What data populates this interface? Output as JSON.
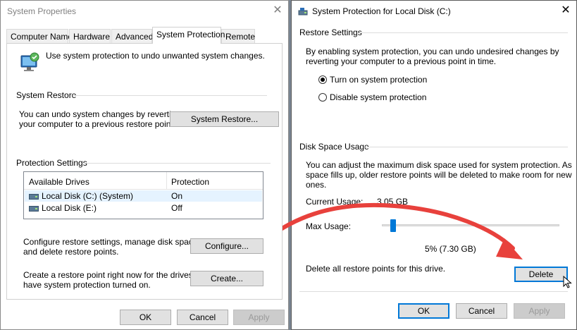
{
  "left_dialog": {
    "title": "System Properties",
    "tabs": [
      "Computer Name",
      "Hardware",
      "Advanced",
      "System Protection",
      "Remote"
    ],
    "active_tab": "System Protection",
    "intro_text": "Use system protection to undo unwanted system changes.",
    "system_restore": {
      "heading": "System Restore",
      "description_line1": "You can undo system changes by reverting",
      "description_line2": "your computer to a previous restore point.",
      "button": "System Restore..."
    },
    "protection_settings": {
      "heading": "Protection Settings",
      "columns": [
        "Available Drives",
        "Protection"
      ],
      "rows": [
        {
          "drive": "Local Disk (C:) (System)",
          "protection": "On"
        },
        {
          "drive": "Local Disk (E:)",
          "protection": "Off"
        }
      ],
      "configure_text_line1": "Configure restore settings, manage disk space,",
      "configure_text_line2": "and delete restore points.",
      "configure_button": "Configure...",
      "create_text_line1": "Create a restore point right now for the drives that",
      "create_text_line2": "have system protection turned on.",
      "create_button": "Create..."
    },
    "footer": {
      "ok": "OK",
      "cancel": "Cancel",
      "apply": "Apply"
    }
  },
  "right_dialog": {
    "title": "System Protection for Local Disk (C:)",
    "restore_settings": {
      "heading": "Restore Settings",
      "description_line1": "By enabling system protection, you can undo undesired changes by",
      "description_line2": "reverting your computer to a previous point in time.",
      "options": [
        {
          "label": "Turn on system protection",
          "checked": true
        },
        {
          "label": "Disable system protection",
          "checked": false
        }
      ]
    },
    "disk_space": {
      "heading": "Disk Space Usage",
      "description_line1": "You can adjust the maximum disk space used for system protection. As",
      "description_line2": "space fills up, older restore points will be deleted to make room for new",
      "description_line3": "ones.",
      "current_usage_label": "Current Usage:",
      "current_usage_value": "3.05 GB",
      "max_usage_label": "Max Usage:",
      "max_usage_fraction": 0.05,
      "max_usage_value": "5% (7.30 GB)",
      "delete_text": "Delete all restore points for this drive.",
      "delete_button": "Delete"
    },
    "footer": {
      "ok": "OK",
      "cancel": "Cancel",
      "apply": "Apply"
    }
  },
  "colors": {
    "annotation_arrow": "#e8413c",
    "accent": "#0078d7"
  }
}
